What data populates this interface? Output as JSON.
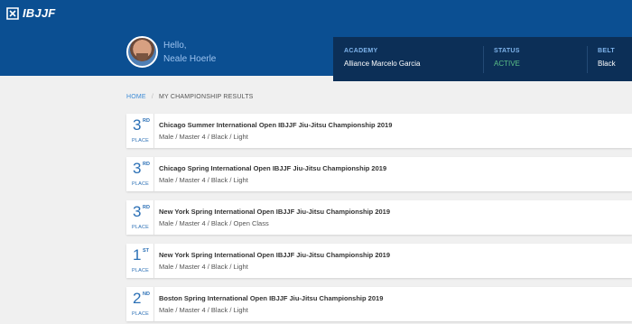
{
  "brand": {
    "name": "IBJJF"
  },
  "user": {
    "greeting": "Hello,",
    "name": "Neale Hoerle"
  },
  "info": {
    "academy_label": "ACADEMY",
    "academy": "Alliance Marcelo Garcia",
    "status_label": "STATUS",
    "status": "ACTIVE",
    "belt_label": "BELT",
    "belt": "Black"
  },
  "breadcrumb": {
    "home": "HOME",
    "sep": "/",
    "current": "MY CHAMPIONSHIP RESULTS"
  },
  "results": [
    {
      "place": "3",
      "suffix": "RD",
      "place_word": "PLACE",
      "title": "Chicago Summer International Open IBJJF Jiu-Jitsu Championship 2019",
      "division": "Male / Master 4 / Black / Light"
    },
    {
      "place": "3",
      "suffix": "RD",
      "place_word": "PLACE",
      "title": "Chicago Spring International Open IBJJF Jiu-Jitsu Championship 2019",
      "division": "Male / Master 4 / Black / Light"
    },
    {
      "place": "3",
      "suffix": "RD",
      "place_word": "PLACE",
      "title": "New York Spring International Open IBJJF Jiu-Jitsu Championship 2019",
      "division": "Male / Master 4 / Black / Open Class"
    },
    {
      "place": "1",
      "suffix": "ST",
      "place_word": "PLACE",
      "title": "New York Spring International Open IBJJF Jiu-Jitsu Championship 2019",
      "division": "Male / Master 4 / Black / Light"
    },
    {
      "place": "2",
      "suffix": "ND",
      "place_word": "PLACE",
      "title": "Boston Spring International Open IBJJF Jiu-Jitsu Championship 2019",
      "division": "Male / Master 4 / Black / Light"
    }
  ],
  "colors": {
    "header": "#0b4f92",
    "panel": "#0c2f57",
    "accent": "#2a6fb5",
    "active": "#5bbf86"
  }
}
